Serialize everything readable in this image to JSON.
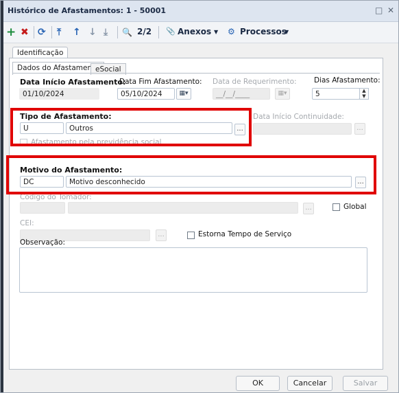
{
  "window": {
    "title": "Histórico de Afastamentos: 1 - 50001",
    "restore_glyph": "□",
    "close_glyph": "✕"
  },
  "toolbar": {
    "add_icon": "+",
    "delete_icon": "✖",
    "refresh_icon": "⟳",
    "first_icon": "⤒",
    "prev_icon": "↑",
    "next_icon": "↓",
    "last_icon": "⤓",
    "search_icon": "🔍",
    "record_position": "2/2",
    "attachments_label": "Anexos",
    "processes_label": "Processos",
    "dropdown_arrow": "▼",
    "paperclip_icon": "📎",
    "gear_icon": "⚙"
  },
  "tabs": {
    "outer": "Identificação",
    "inner": [
      "Dados do Afastamento",
      "eSocial"
    ]
  },
  "fields": {
    "data_inicio": {
      "label": "Data Início Afastamento:",
      "value": "01/10/2024"
    },
    "data_fim": {
      "label": "Data Fim Afastamento:",
      "value": "05/10/2024"
    },
    "data_requerimento": {
      "label": "Data de Requerimento:",
      "value": "__/__/____"
    },
    "dias": {
      "label": "Dias Afastamento:",
      "value": "5"
    },
    "tipo": {
      "label": "Tipo de Afastamento:",
      "code": "U",
      "description": "Outros"
    },
    "data_inicio_continuidade": {
      "label": "Data Início Continuidade:"
    },
    "afastamento_previdencia": {
      "label": "Afastamento pela previdência social"
    },
    "motivo": {
      "label": "Motivo do Afastamento:",
      "code": "DC",
      "description": "Motivo desconhecido"
    },
    "codigo_tomador": {
      "label": "Código do Tomador:"
    },
    "global": {
      "label": "Global"
    },
    "cei": {
      "label": "CEI:"
    },
    "estorna": {
      "label": "Estorna Tempo de Serviço"
    },
    "observacao": {
      "label": "Observação:"
    }
  },
  "buttons": {
    "lookup": "...",
    "calendar": "▦▾",
    "spin_up": "▲",
    "spin_down": "▼",
    "ok": "OK",
    "cancel": "Cancelar",
    "save": "Salvar"
  },
  "colors": {
    "highlight_red": "#e00000",
    "add_green": "#1c8c3c",
    "delete_red": "#c41a1a",
    "nav_blue": "#2864b4"
  }
}
